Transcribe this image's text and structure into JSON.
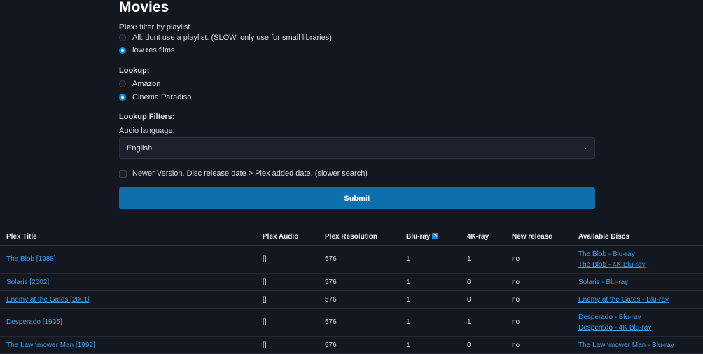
{
  "page": {
    "title": "Movies"
  },
  "plex_filter": {
    "label_bold": "Plex:",
    "label_rest": "filter by playlist",
    "options": [
      {
        "label": "All: dont use a playlist. (SLOW, only use for small libraries)",
        "selected": false
      },
      {
        "label": "low res films",
        "selected": true
      }
    ]
  },
  "lookup": {
    "label": "Lookup:",
    "options": [
      {
        "label": "Amazon",
        "selected": false
      },
      {
        "label": "Cinema Paradiso",
        "selected": true
      }
    ]
  },
  "lookup_filters": {
    "label": "Lookup Filters:",
    "audio_label": "Audio language:",
    "audio_value": "English"
  },
  "newer_version": {
    "label": "Newer Version. Disc release date > Plex added date. (slower search)",
    "checked": false
  },
  "submit_label": "Submit",
  "table": {
    "headers": [
      "Plex Title",
      "Plex Audio",
      "Plex Resolution",
      "Blu-ray",
      "4K-ray",
      "New release",
      "Available Discs"
    ],
    "rows": [
      {
        "title": "The Blob [1988]",
        "audio": "[]",
        "resolution": "576",
        "bluray": "1",
        "k4": "1",
        "new_release": "no",
        "discs": [
          "The Blob - Blu-ray",
          "The Blob - 4K Blu-ray"
        ]
      },
      {
        "title": "Solaris [2002]",
        "audio": "[]",
        "resolution": "576",
        "bluray": "1",
        "k4": "0",
        "new_release": "no",
        "discs": [
          "Solaris - Blu-ray"
        ]
      },
      {
        "title": "Enemy at the Gates [2001]",
        "audio": "[]",
        "resolution": "576",
        "bluray": "1",
        "k4": "0",
        "new_release": "no",
        "discs": [
          "Enemy at the Gates - Blu-ray"
        ]
      },
      {
        "title": "Desperado [1995]",
        "audio": "[]",
        "resolution": "576",
        "bluray": "1",
        "k4": "1",
        "new_release": "no",
        "discs": [
          "Desperado - Blu-ray",
          "Desperado - 4K Blu-ray"
        ]
      },
      {
        "title": "The Lawnmower Man [1992]",
        "audio": "[]",
        "resolution": "576",
        "bluray": "1",
        "k4": "0",
        "new_release": "no",
        "discs": [
          "The Lawnmower Man - Blu-ray"
        ]
      }
    ]
  },
  "icons": {
    "sort": "sort-descending-icon",
    "chevron": "chevron-down-icon"
  },
  "colors": {
    "background": "#13171f",
    "accent": "#0e6fad",
    "link": "#3aa0e8"
  }
}
